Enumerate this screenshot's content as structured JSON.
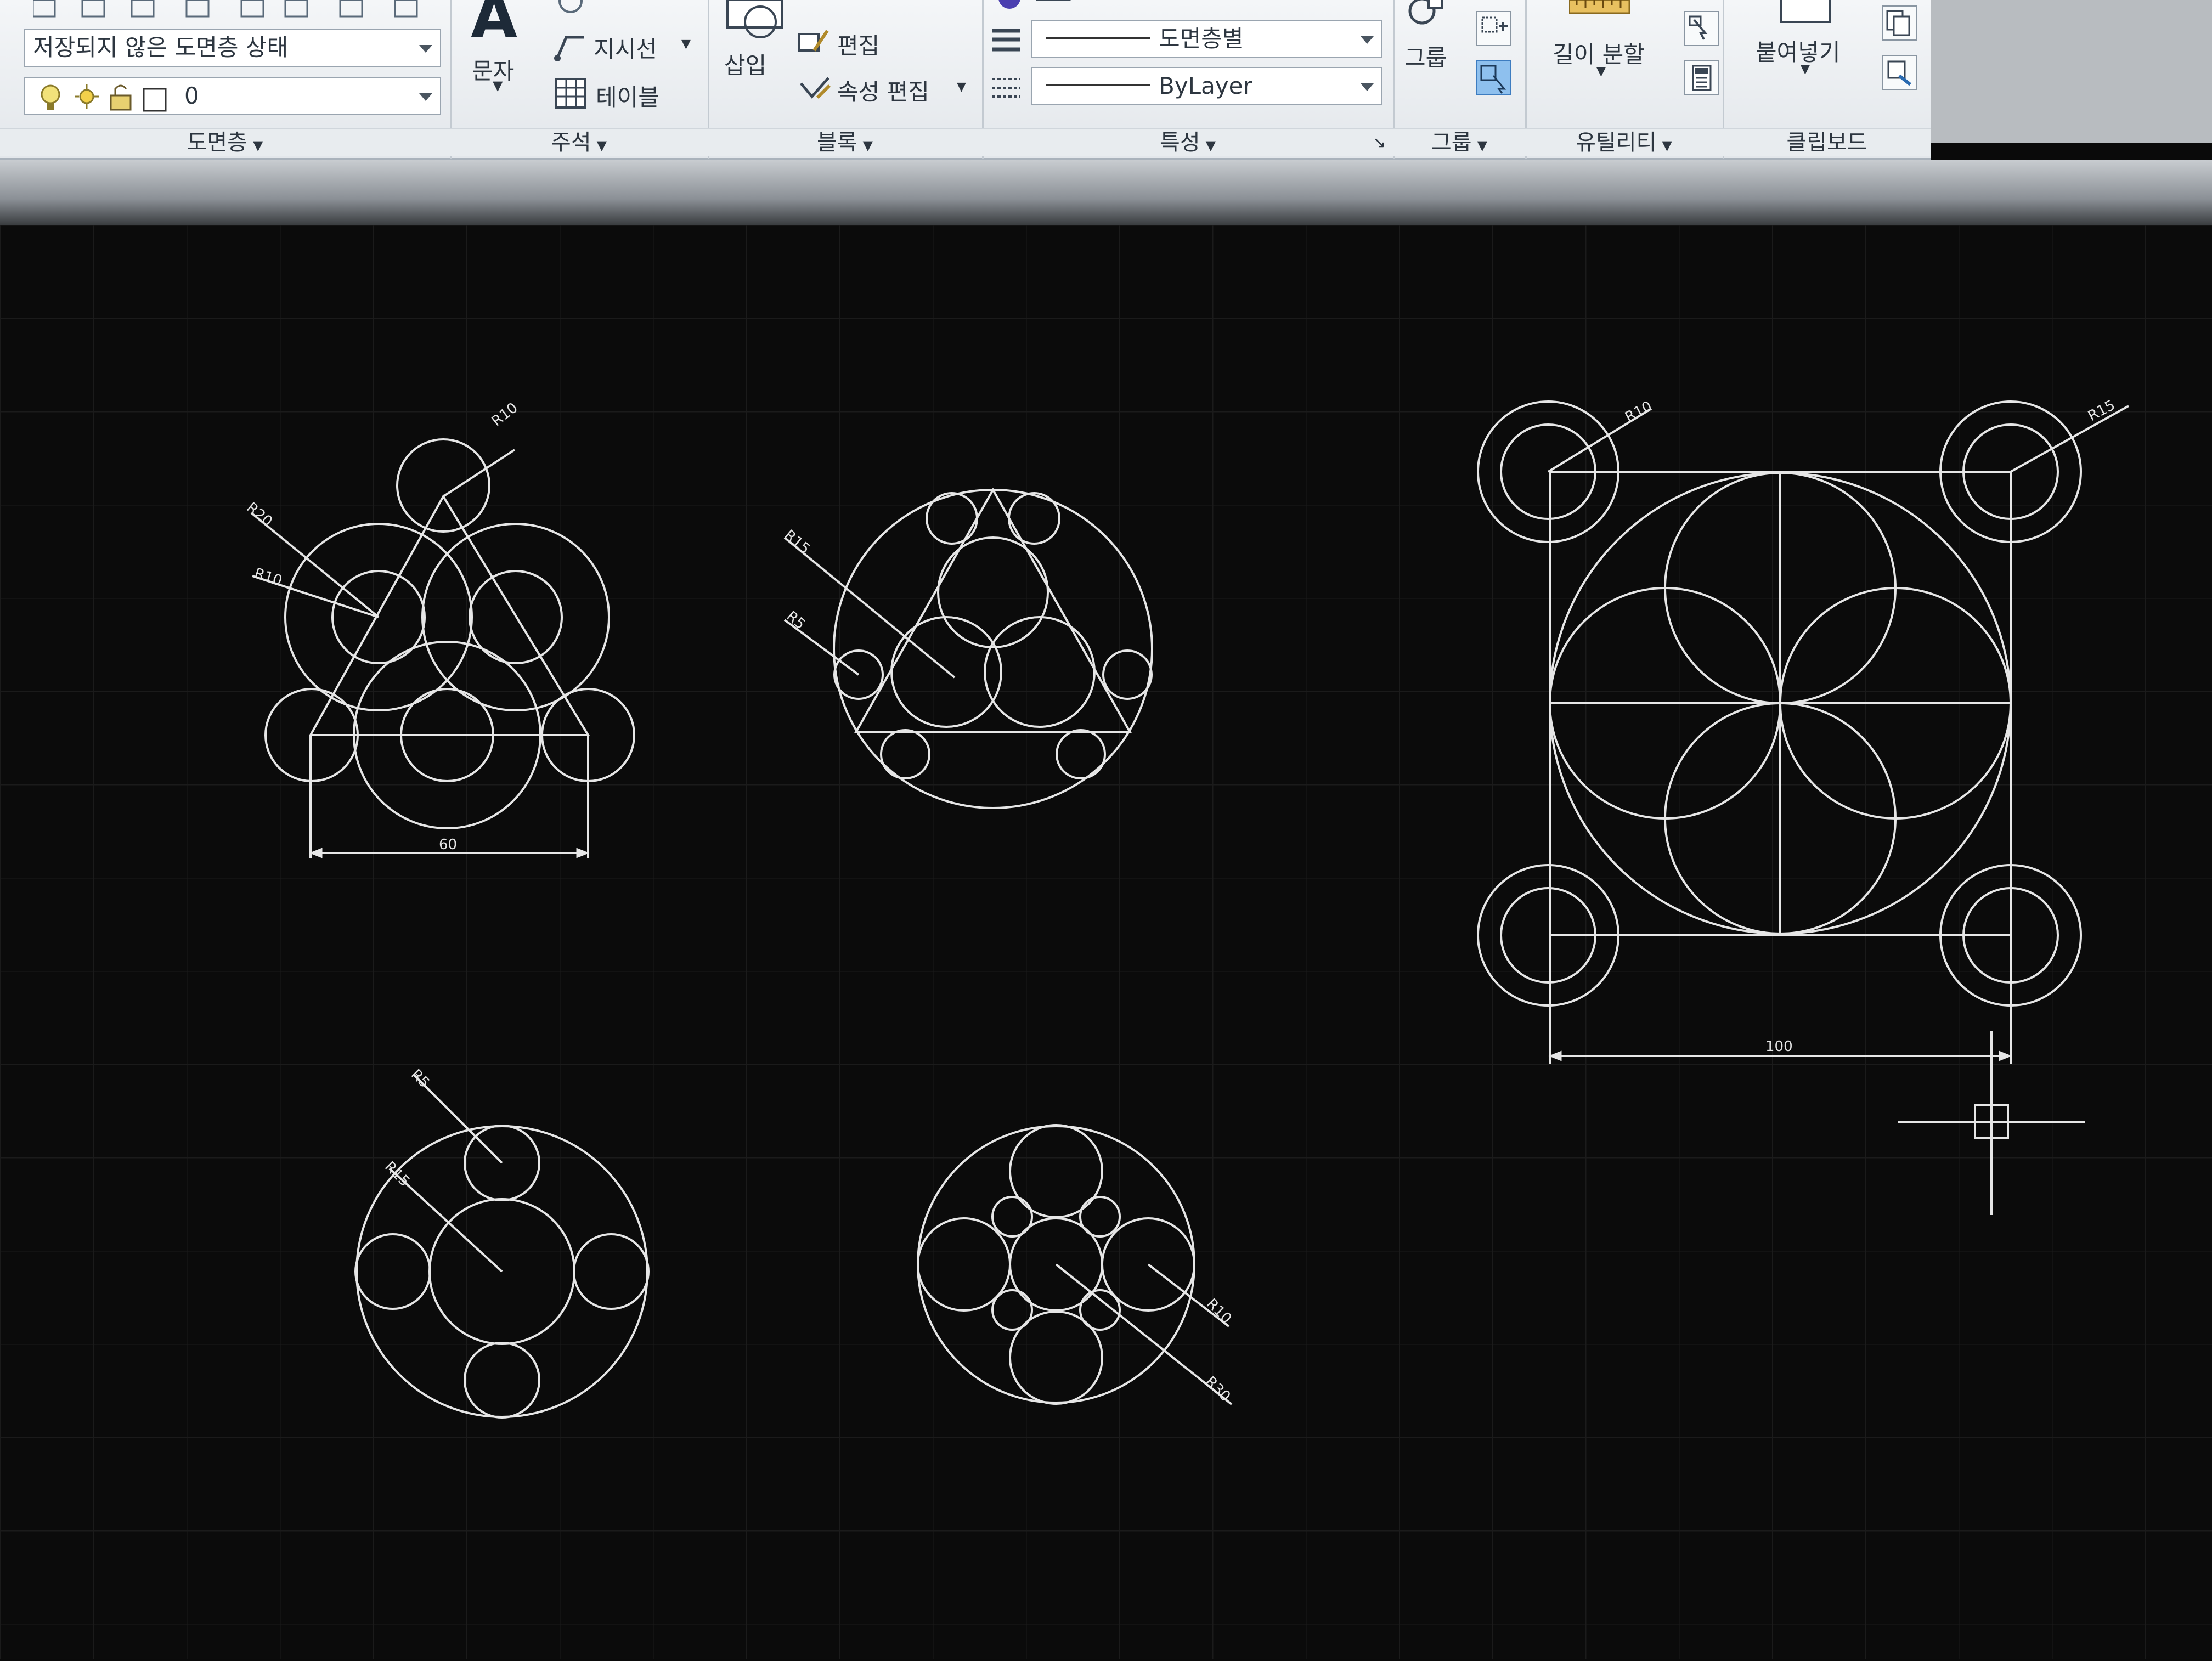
{
  "ribbon": {
    "layer_panel": {
      "state_combo": "저장되지 않은 도면층 상태",
      "layer_combo": "0",
      "title": "도면층"
    },
    "annotation_panel": {
      "text_button": "문자",
      "leader_button": "지시선",
      "table_button": "테이블",
      "title": "주석"
    },
    "block_panel": {
      "insert_button": "삽입",
      "edit_button": "편집",
      "attr_edit_button": "속성 편집",
      "title": "블록"
    },
    "properties_panel": {
      "lineweight_combo": "도면층별",
      "linetype_combo": "ByLayer",
      "title": "특성"
    },
    "group_panel": {
      "group_button": "그룹",
      "title": "그룹"
    },
    "utility_panel": {
      "measure_button": "길이 분할",
      "title": "유틸리티"
    },
    "clipboard_panel": {
      "paste_button": "붙여넣기",
      "title": "클립보드"
    }
  },
  "drawing": {
    "dims": {
      "d1_r10": "R10",
      "d1_r20": "R20",
      "d1_r10b": "R10",
      "d1_width": "60",
      "d2_r15": "R15",
      "d2_r5": "R5",
      "d3_r10": "R10",
      "d3_r15": "R15",
      "d3_width": "100",
      "d4_r5": "R5",
      "d4_r15": "R15",
      "d5_r10": "R10",
      "d5_r30": "R30"
    }
  },
  "colors": {
    "line": "#e6e6e6",
    "canvas": "#0b0b0b",
    "grid": "#1b1b1b"
  }
}
